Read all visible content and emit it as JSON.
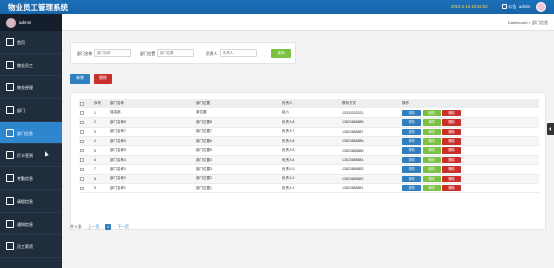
{
  "app": {
    "title": "物业员工管理系统",
    "datetime": "2024-2-16 15:52:53",
    "message_label": "公告",
    "user_name": "admin"
  },
  "sidebar": {
    "user_name": "admin",
    "items": [
      {
        "label": "首页",
        "icon": "home-icon"
      },
      {
        "label": "物业员工",
        "icon": "users-icon"
      },
      {
        "label": "物业经理",
        "icon": "user-tie-icon"
      },
      {
        "label": "部门",
        "icon": "building-icon"
      },
      {
        "label": "部门信息",
        "icon": "grid-icon",
        "active": true
      },
      {
        "label": "打卡签到",
        "icon": "clock-icon"
      },
      {
        "label": "考勤信息",
        "icon": "calendar-icon"
      },
      {
        "label": "请假信息",
        "icon": "leave-icon"
      },
      {
        "label": "通知信息",
        "icon": "send-icon"
      },
      {
        "label": "员工薪资",
        "icon": "wallet-icon"
      }
    ]
  },
  "breadcrumb": "Dashboard > 部门信息",
  "search": {
    "fields": [
      {
        "label": "部门名称",
        "placeholder": "部门名称"
      },
      {
        "label": "部门位置",
        "placeholder": "部门位置"
      },
      {
        "label": "负责人",
        "placeholder": "负责人"
      }
    ],
    "query_label": "查询"
  },
  "actions": {
    "add_label": "新增",
    "delete_label": "删除"
  },
  "table": {
    "headers": [
      "",
      "序号",
      "部门名称",
      "部门位置",
      "负责人",
      "联系方式",
      "操作"
    ],
    "op_labels": {
      "detail": "详情",
      "edit": "修改",
      "delete": "删除"
    },
    "rows": [
      {
        "idx": "1",
        "name": "保洁部",
        "location": "某位置",
        "head": "赵六",
        "phone": "13333333221"
      },
      {
        "idx": "2",
        "name": "部门名称8",
        "location": "部门位置8",
        "head": "负责人8",
        "phone": "13823888888"
      },
      {
        "idx": "3",
        "name": "部门名称7",
        "location": "部门位置7",
        "head": "负责人7",
        "phone": "13823888887"
      },
      {
        "idx": "4",
        "name": "部门名称6",
        "location": "部门位置6",
        "head": "负责人6",
        "phone": "13823888886"
      },
      {
        "idx": "5",
        "name": "部门名称5",
        "location": "部门位置5",
        "head": "负责人5",
        "phone": "13823888885"
      },
      {
        "idx": "6",
        "name": "部门名称4",
        "location": "部门位置4",
        "head": "负责人4",
        "phone": "13823888884"
      },
      {
        "idx": "7",
        "name": "部门名称3",
        "location": "部门位置3",
        "head": "负责人3",
        "phone": "13823888883"
      },
      {
        "idx": "8",
        "name": "部门名称2",
        "location": "部门位置2",
        "head": "负责人2",
        "phone": "13823888882"
      },
      {
        "idx": "9",
        "name": "部门名称1",
        "location": "部门位置1",
        "head": "负责人1",
        "phone": "13823888881"
      }
    ]
  },
  "pagination": {
    "total_label": "共 9 条",
    "prev_label": "上一页",
    "current_page": "1",
    "next_label": "下一页"
  },
  "colors": {
    "topbar": "#1d6fb8",
    "sidebar": "#1f2d3d",
    "active_menu": "#2e86cf",
    "primary": "#2f7fc1",
    "success": "#7dc142",
    "danger": "#c9302c",
    "date_text": "#ffd84a"
  }
}
